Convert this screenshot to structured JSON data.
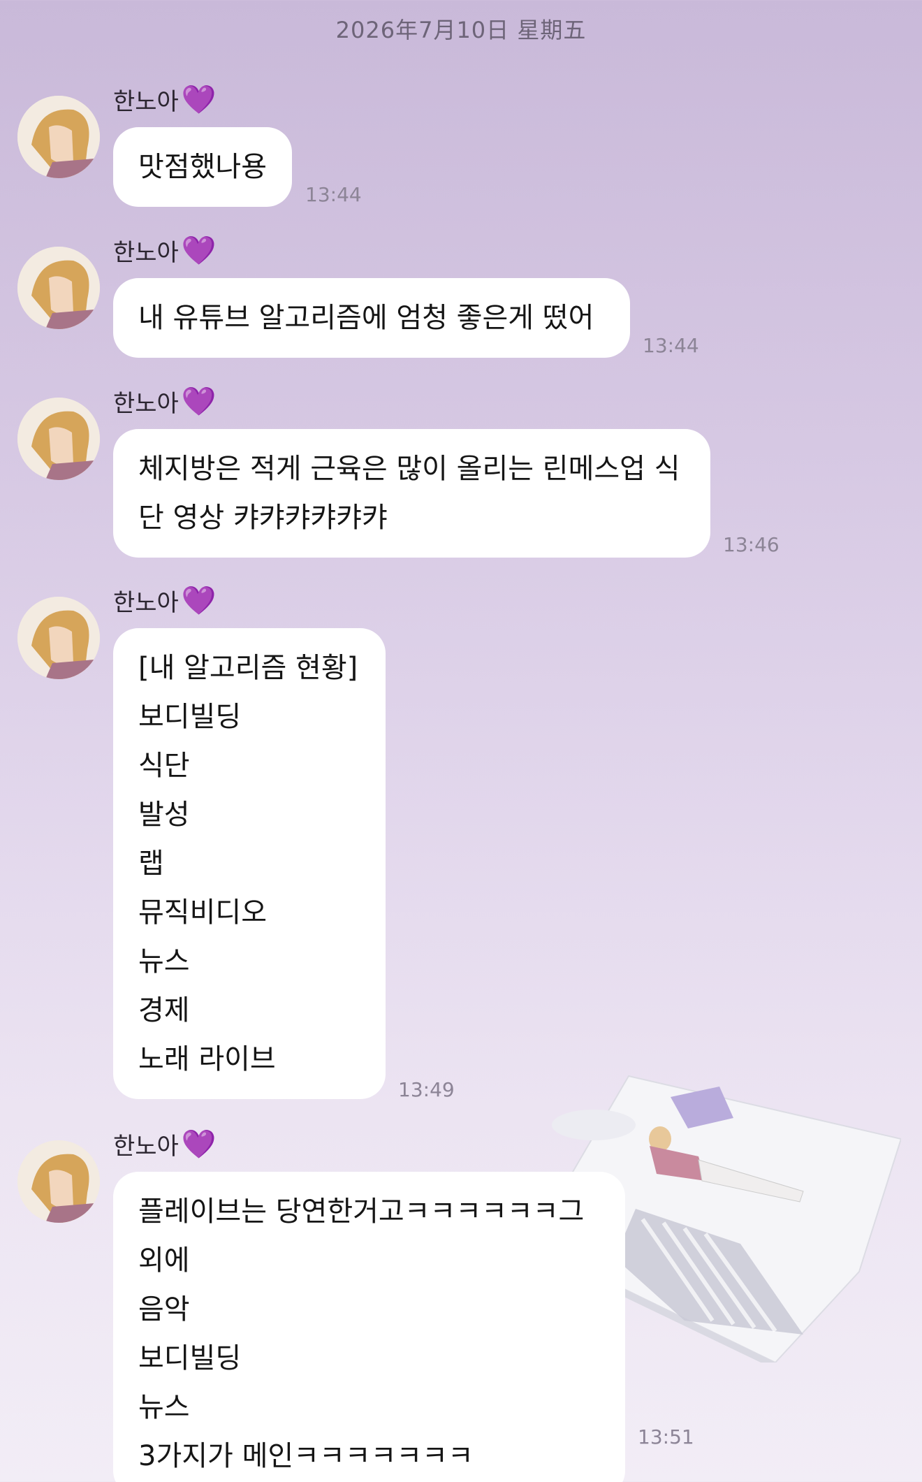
{
  "date_divider": "2026年7月10日 星期五",
  "messages": [
    {
      "sender": "한노아",
      "heart": "💜",
      "text": "맛점했나용",
      "time": "13:44"
    },
    {
      "sender": "한노아",
      "heart": "💜",
      "text": "내 유튜브 알고리즘에 엄청 좋은게 떴어",
      "time": "13:44"
    },
    {
      "sender": "한노아",
      "heart": "💜",
      "text": "체지방은 적게 근육은 많이 올리는 린메스업 식\n단 영상 캬캬캬캬캬캬",
      "time": "13:46"
    },
    {
      "sender": "한노아",
      "heart": "💜",
      "text": "[내 알고리즘 현황]\n보디빌딩\n식단\n발성\n랩\n뮤직비디오\n뉴스\n경제\n노래 라이브",
      "time": "13:49"
    },
    {
      "sender": "한노아",
      "heart": "💜",
      "text": "플레이브는 당연한거고ㅋㅋㅋㅋㅋㅋ그 외에\n음악\n보디빌딩\n뉴스\n3가지가 메인ㅋㅋㅋㅋㅋㅋㅋ",
      "time": "13:51"
    }
  ],
  "icons": {
    "avatar": "profile-avatar-illustration",
    "heart": "purple-heart-emoji",
    "decoration": "character-lying-on-bed-illustration"
  },
  "colors": {
    "background_top": "#c9b9d9",
    "background_bottom": "#f2edf6",
    "bubble": "#ffffff",
    "heart": "#9a3fe0"
  }
}
